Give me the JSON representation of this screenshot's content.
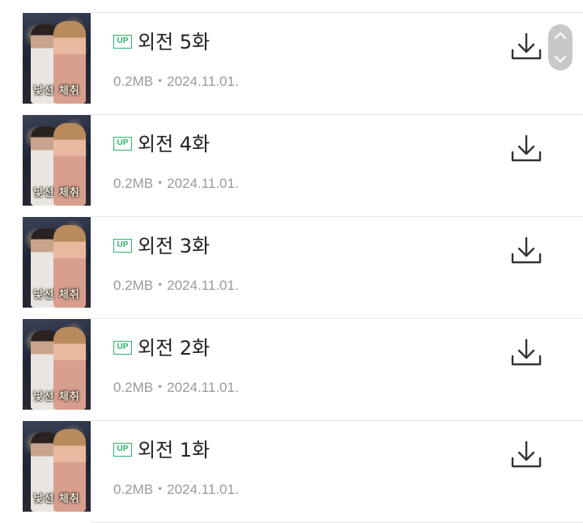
{
  "episodes": [
    {
      "badge": "UP",
      "title": "외전 5화",
      "meta": "0.2MB・2024.11.01.",
      "cover_title": "낯선 체취"
    },
    {
      "badge": "UP",
      "title": "외전 4화",
      "meta": "0.2MB・2024.11.01.",
      "cover_title": "낯선 체취"
    },
    {
      "badge": "UP",
      "title": "외전 3화",
      "meta": "0.2MB・2024.11.01.",
      "cover_title": "낯선 체취"
    },
    {
      "badge": "UP",
      "title": "외전 2화",
      "meta": "0.2MB・2024.11.01.",
      "cover_title": "낯선 체취"
    },
    {
      "badge": "UP",
      "title": "외전 1화",
      "meta": "0.2MB・2024.11.01.",
      "cover_title": "낯선 체취"
    }
  ],
  "icons": {
    "download": "download-icon",
    "scroll_up": "chevron-up-icon",
    "scroll_down": "chevron-down-icon"
  },
  "colors": {
    "badge": "#2fb36b",
    "title": "#222222",
    "meta": "#9a9a9a",
    "icon": "#333333"
  }
}
